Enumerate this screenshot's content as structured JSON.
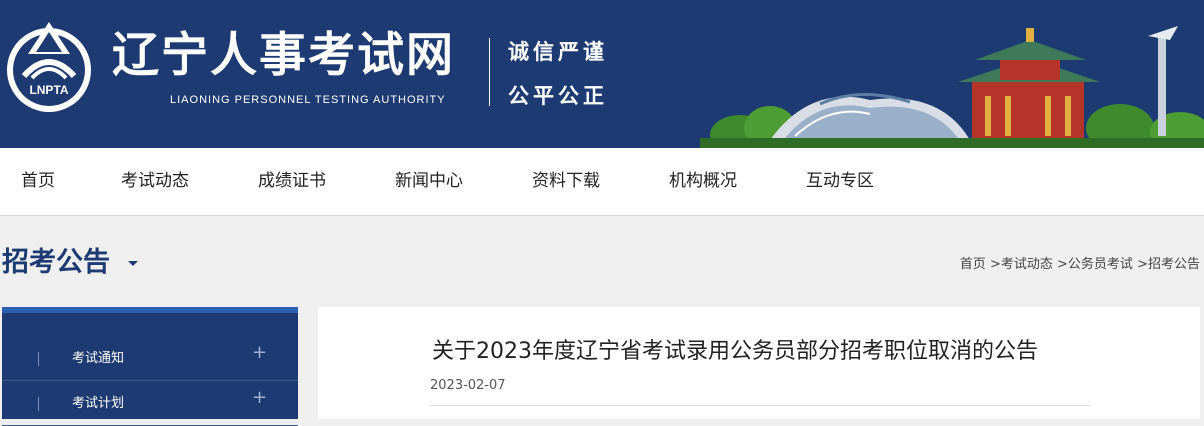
{
  "header": {
    "logo_text": "LNPTA",
    "site_title": "辽宁人事考试网",
    "site_subtitle": "LIAONING PERSONNEL TESTING AUTHORITY",
    "slogan_line1": "诚信严谨",
    "slogan_line2": "公平公正",
    "colors": {
      "banner": "#1d3b72",
      "accent": "#2b61b3"
    }
  },
  "nav": {
    "items": [
      {
        "label": "首页"
      },
      {
        "label": "考试动态"
      },
      {
        "label": "成绩证书"
      },
      {
        "label": "新闻中心"
      },
      {
        "label": "资料下载"
      },
      {
        "label": "机构概况"
      },
      {
        "label": "互动专区"
      }
    ]
  },
  "section": {
    "title": "招考公告",
    "breadcrumb": [
      "首页",
      "考试动态",
      "公务员考试",
      "招考公告"
    ],
    "breadcrumb_separator": ">"
  },
  "sidebar": {
    "items": [
      {
        "label": "考试通知",
        "icon": "plus-icon"
      },
      {
        "label": "考试计划",
        "icon": "plus-icon"
      }
    ]
  },
  "article": {
    "title": "关于2023年度辽宁省考试录用公务员部分招考职位取消的公告",
    "date": "2023-02-07"
  }
}
